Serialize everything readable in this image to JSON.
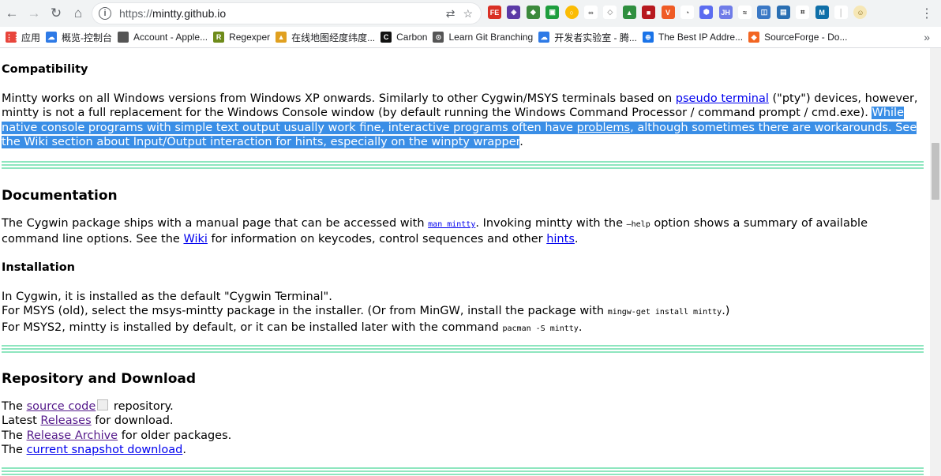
{
  "browser": {
    "url_scheme": "https://",
    "url_host": "mintty.github.io",
    "menu_glyph": "⋮"
  },
  "bookmarks": [
    {
      "label": "应用",
      "icon": "apps-grid-icon",
      "color": "#e8453c"
    },
    {
      "label": "概览-控制台",
      "icon": "cloud-icon",
      "color": "#2e7ae6"
    },
    {
      "label": "Account - Apple...",
      "icon": "apple-icon",
      "color": "#555555"
    },
    {
      "label": "Regexper",
      "icon": "regexper-icon",
      "color": "#6e8b1a"
    },
    {
      "label": "在线地图经度纬度...",
      "icon": "map-icon",
      "color": "#e0a020"
    },
    {
      "label": "Carbon",
      "icon": "carbon-icon",
      "color": "#111111"
    },
    {
      "label": "Learn Git Branching",
      "icon": "git-icon",
      "color": "#555555"
    },
    {
      "label": "开发者实验室 - 腾...",
      "icon": "cloud-icon",
      "color": "#2e7ae6"
    },
    {
      "label": "The Best IP Addre...",
      "icon": "ip-icon",
      "color": "#1a73e8"
    },
    {
      "label": "SourceForge - Do...",
      "icon": "sourceforge-icon",
      "color": "#f26522"
    }
  ],
  "compat": {
    "heading": "Compatibility",
    "p1_a": "Mintty works on all Windows versions from Windows XP onwards. Similarly to other Cygwin/MSYS terminals based on ",
    "p1_link": "pseudo terminal",
    "p1_b": " (\"pty\") devices, however, mintty is not a full replacement for the Windows Console window (by default running the Windows Command Processor / command prompt / cmd.exe). ",
    "p1_hl_a": "While native console programs with simple text output usually work fine, interactive programs often have ",
    "p1_hl_b": "problems",
    "p1_hl_c": ", although sometimes there are workarounds. See the Wiki section about Input/Output interaction for hints, especially on the winpty wrapper",
    "p1_end": "."
  },
  "docs": {
    "heading": "Documentation",
    "p_a": "The Cygwin package ships with a manual page that can be accessed with ",
    "p_code_link": "man mintty",
    "p_b": ". Invoking mintty with the ",
    "p_code": "—help",
    "p_c": " option shows a summary of available command line options. See the ",
    "p_wiki": "Wiki",
    "p_d": " for information on keycodes, control sequences and other ",
    "p_hints": "hints",
    "p_e": "."
  },
  "install": {
    "heading": "Installation",
    "l1": "In Cygwin, it is installed as the default \"Cygwin Terminal\".",
    "l2_a": "For MSYS (old), select the msys-mintty package in the installer. (Or from MinGW, install the package with ",
    "l2_code": "mingw-get install mintty",
    "l2_b": ".)",
    "l3_a": "For MSYS2, mintty is installed by default, or it can be installed later with the command ",
    "l3_code": "pacman -S mintty",
    "l3_b": "."
  },
  "repo": {
    "heading": "Repository and Download",
    "l1_a": "The ",
    "l1_link": "source code",
    "l1_b": " repository.",
    "l2_a": "Latest ",
    "l2_link": "Releases",
    "l2_b": " for download.",
    "l3_a": "The ",
    "l3_link": "Release Archive",
    "l3_b": " for older packages.",
    "l4_a": "The ",
    "l4_link": "current snapshot download",
    "l4_b": "."
  }
}
